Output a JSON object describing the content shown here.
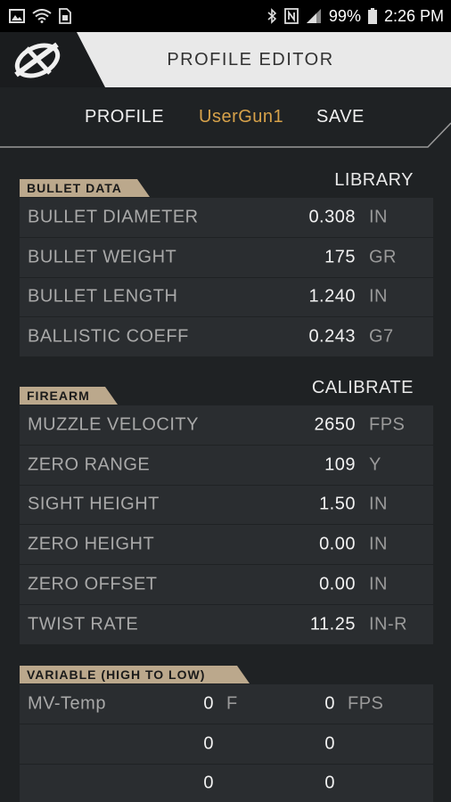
{
  "status_bar": {
    "battery": "99%",
    "time": "2:26 PM",
    "left_icons": [
      "image-icon",
      "wifi-icon",
      "sim-icon"
    ],
    "right_icons": [
      "bluetooth-icon",
      "nfc-icon",
      "signal-icon",
      "battery-icon"
    ]
  },
  "header": {
    "title": "PROFILE EDITOR",
    "logo": "crosshair-logo"
  },
  "nav": {
    "profile": "PROFILE",
    "profile_name": "UserGun1",
    "save": "SAVE"
  },
  "colors": {
    "accent_gold": "#d7a24a",
    "tag_bg": "#bba88c",
    "panel_bg": "#2a2d30",
    "background": "#1f2224"
  },
  "bullet": {
    "heading": "BULLET DATA",
    "action": "LIBRARY",
    "rows": [
      {
        "label": "BULLET DIAMETER",
        "value": "0.308",
        "unit": "IN"
      },
      {
        "label": "BULLET WEIGHT",
        "value": "175",
        "unit": "GR"
      },
      {
        "label": "BULLET LENGTH",
        "value": "1.240",
        "unit": "IN"
      },
      {
        "label": "BALLISTIC COEFF",
        "value": "0.243",
        "unit": "G7"
      }
    ]
  },
  "firearm": {
    "heading": "FIREARM",
    "action": "CALIBRATE",
    "rows": [
      {
        "label": "MUZZLE VELOCITY",
        "value": "2650",
        "unit": "FPS"
      },
      {
        "label": "ZERO RANGE",
        "value": "109",
        "unit": "Y"
      },
      {
        "label": "SIGHT HEIGHT",
        "value": "1.50",
        "unit": "IN"
      },
      {
        "label": "ZERO HEIGHT",
        "value": "0.00",
        "unit": "IN"
      },
      {
        "label": "ZERO OFFSET",
        "value": "0.00",
        "unit": "IN"
      },
      {
        "label": "TWIST RATE",
        "value": "11.25",
        "unit": "IN-R"
      }
    ]
  },
  "variable": {
    "heading": "VARIABLE (HIGH TO LOW)",
    "rows": [
      {
        "label": "MV-Temp",
        "v1": "0",
        "u1": "F",
        "v2": "0",
        "u2": "FPS"
      },
      {
        "label": "",
        "v1": "0",
        "u1": "",
        "v2": "0",
        "u2": ""
      },
      {
        "label": "",
        "v1": "0",
        "u1": "",
        "v2": "0",
        "u2": ""
      }
    ]
  }
}
